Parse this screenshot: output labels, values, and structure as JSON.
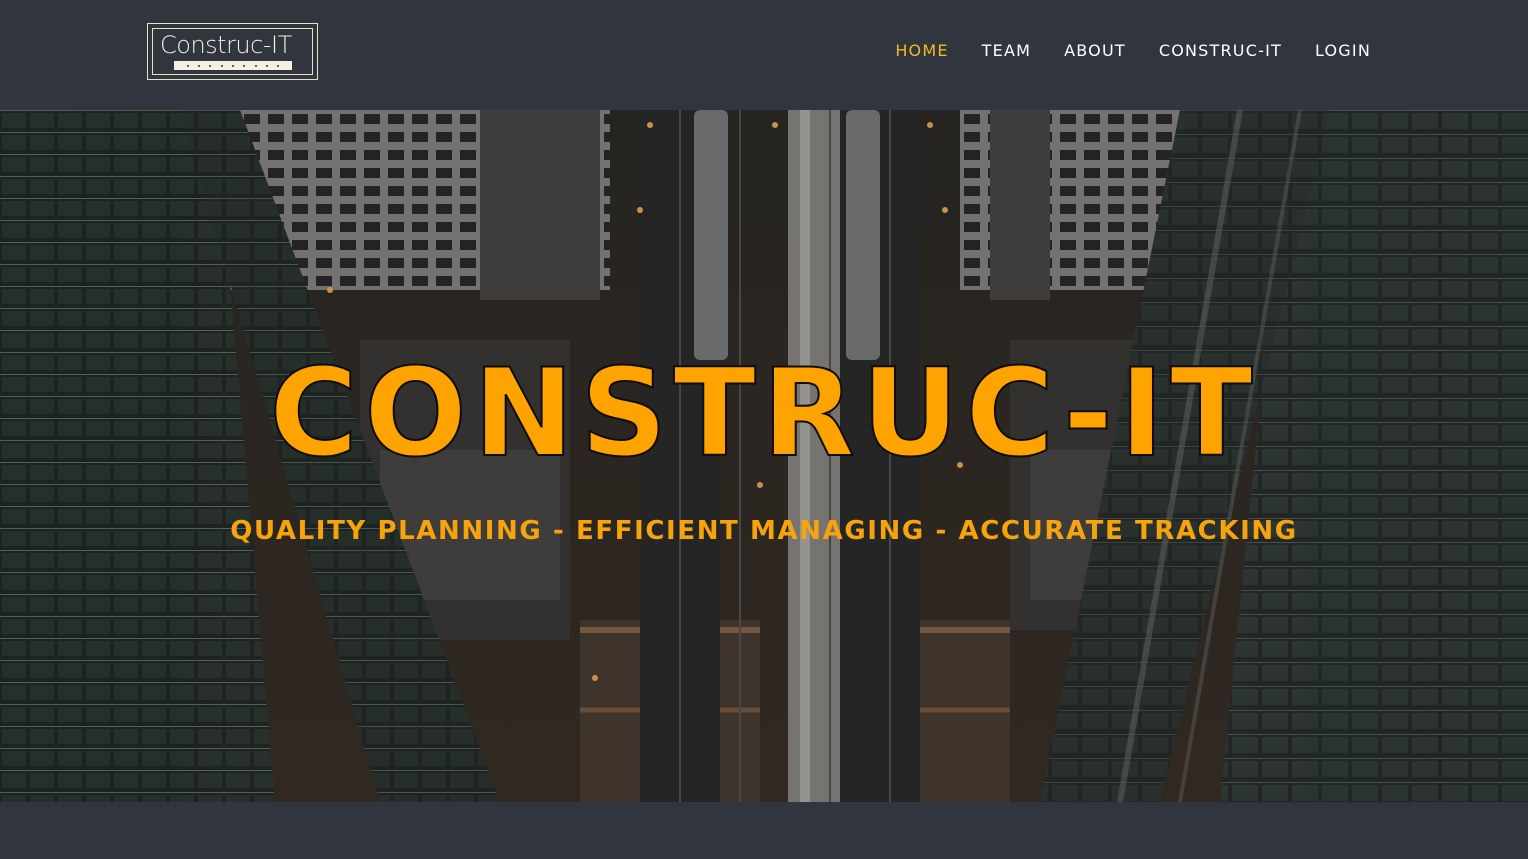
{
  "brand": {
    "logo_text": "Construc-IT"
  },
  "nav": {
    "items": [
      {
        "label": "HOME",
        "active": true
      },
      {
        "label": "TEAM",
        "active": false
      },
      {
        "label": "ABOUT",
        "active": false
      },
      {
        "label": "CONSTRUC-IT",
        "active": false
      },
      {
        "label": "LOGIN",
        "active": false
      }
    ]
  },
  "hero": {
    "title": "CONSTRUC-IT",
    "subtitle": "QUALITY PLANNING - EFFICIENT MANAGING - ACCURATE TRACKING"
  },
  "colors": {
    "background": "#31353e",
    "accent": "#ffa300",
    "nav_active": "#f1b829",
    "nav_text": "#ffffff"
  }
}
